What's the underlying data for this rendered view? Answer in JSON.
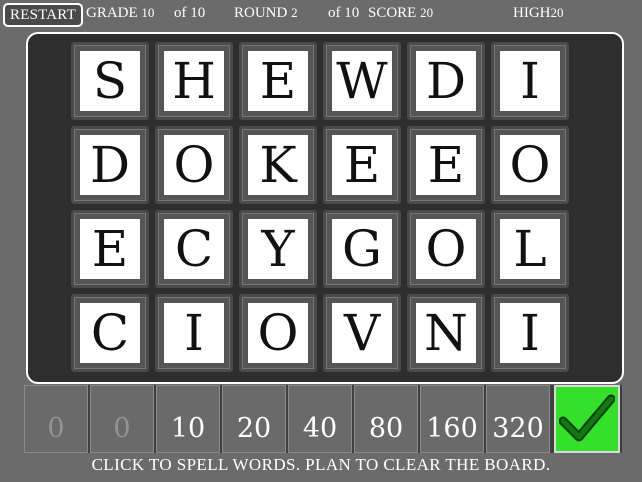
{
  "topbar": {
    "restart_label": "RESTART",
    "grade_label": "GRADE",
    "grade_value": "10",
    "grade_of": "of 10",
    "round_label": "ROUND",
    "round_value": "2",
    "round_of": "of 10",
    "score_label": "SCORE",
    "score_value": "20",
    "high_label": "HIGH",
    "high_value": "20"
  },
  "board": {
    "rows": [
      [
        "S",
        "H",
        "E",
        "W",
        "D",
        "I"
      ],
      [
        "D",
        "O",
        "K",
        "E",
        "E",
        "O"
      ],
      [
        "E",
        "C",
        "Y",
        "G",
        "O",
        "L"
      ],
      [
        "C",
        "I",
        "O",
        "V",
        "N",
        "I"
      ]
    ]
  },
  "scorebar": {
    "slots": [
      {
        "value": "0",
        "dim": true
      },
      {
        "value": "0",
        "dim": true
      },
      {
        "value": "10",
        "dim": false
      },
      {
        "value": "20",
        "dim": false
      },
      {
        "value": "40",
        "dim": false
      },
      {
        "value": "80",
        "dim": false
      },
      {
        "value": "160",
        "dim": false
      },
      {
        "value": "320",
        "dim": false
      }
    ],
    "submit_icon": "checkmark-icon",
    "submit_color": "#34e02a"
  },
  "hint": "CLICK TO SPELL WORDS. PLAN TO CLEAR THE BOARD."
}
